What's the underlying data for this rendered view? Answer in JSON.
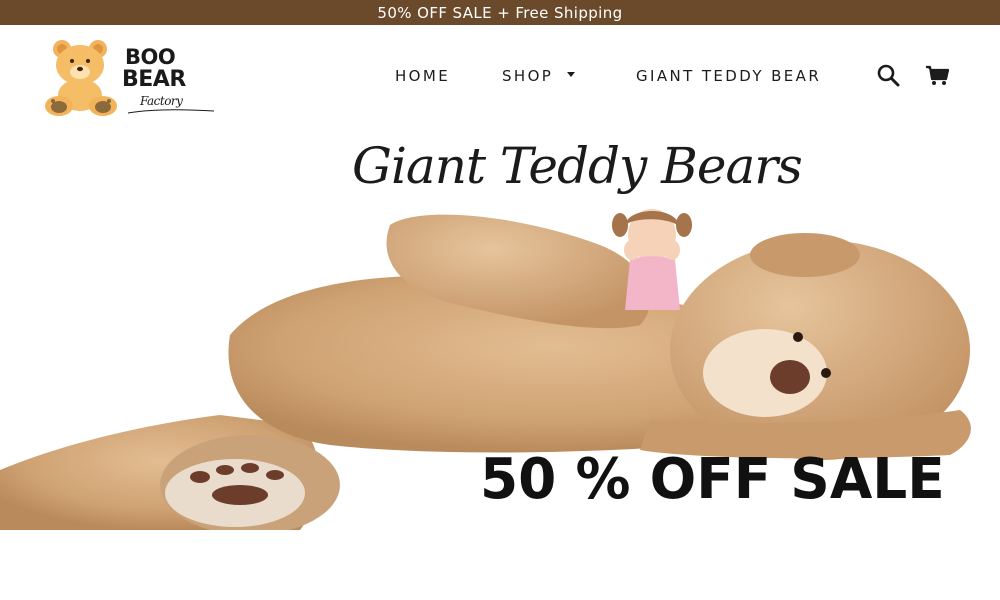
{
  "announcement": {
    "text": "50% OFF SALE + Free Shipping",
    "background": "#6b4a2b"
  },
  "logo": {
    "line1": "BOO",
    "line2": "BEAR",
    "line3": "Factory"
  },
  "nav": {
    "items": [
      {
        "label": "HOME"
      },
      {
        "label": "SHOP",
        "has_dropdown": true
      },
      {
        "label": "GIANT TEDDY BEAR"
      }
    ],
    "search_icon": "search-icon",
    "cart_icon": "cart-icon"
  },
  "hero": {
    "script_title": "Giant Teddy Bears",
    "sale_text": "50 % OFF SALE",
    "image": "giant-teddy-bear-with-child"
  },
  "colors": {
    "brand_brown": "#6b4a2b",
    "bear_tan": "#d4a878",
    "text_dark": "#1c1c1c"
  }
}
